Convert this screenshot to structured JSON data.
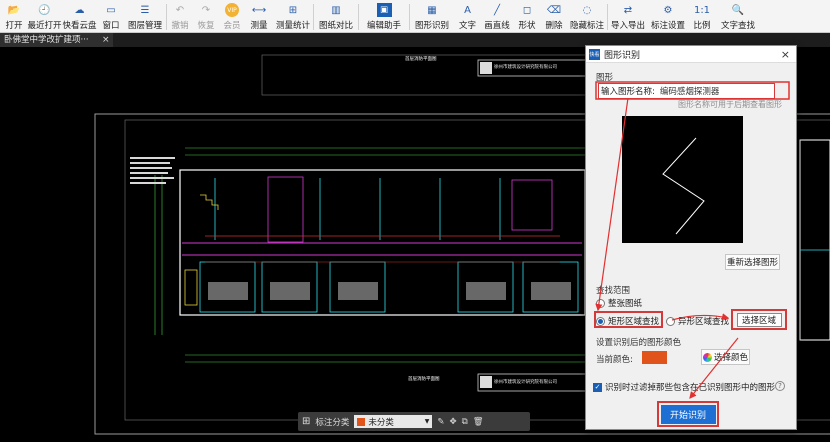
{
  "toolbar": {
    "buttons": [
      {
        "label": "打开",
        "icon": "folder-open-icon",
        "disabled": false
      },
      {
        "label": "最近打开",
        "icon": "recent-clock-icon",
        "disabled": false
      },
      {
        "label": "快看云盘",
        "icon": "cloud-icon",
        "disabled": false
      },
      {
        "label": "窗口",
        "icon": "window-icon",
        "disabled": false
      },
      {
        "label": "图层管理",
        "icon": "layers-icon",
        "disabled": false
      },
      {
        "label": "撤销",
        "icon": "undo-icon",
        "disabled": true
      },
      {
        "label": "恢复",
        "icon": "redo-icon",
        "disabled": true
      },
      {
        "label": "会员",
        "icon": "vip-badge-icon",
        "disabled": true
      },
      {
        "label": "测量",
        "icon": "measure-icon",
        "disabled": false
      },
      {
        "label": "测量统计",
        "icon": "measure-stats-icon",
        "disabled": false
      },
      {
        "label": "图纸对比",
        "icon": "compare-icon",
        "disabled": false
      },
      {
        "label": "编辑助手",
        "icon": "edit-assistant-icon",
        "disabled": false
      },
      {
        "label": "图形识别",
        "icon": "shape-recognition-icon",
        "disabled": false
      },
      {
        "label": "文字",
        "icon": "text-icon",
        "disabled": false
      },
      {
        "label": "画直线",
        "icon": "line-icon",
        "disabled": false
      },
      {
        "label": "形状",
        "icon": "shape-icon",
        "disabled": false
      },
      {
        "label": "删除",
        "icon": "eraser-icon",
        "disabled": false
      },
      {
        "label": "隐藏标注",
        "icon": "hide-annotation-icon",
        "disabled": false
      },
      {
        "label": "导入导出",
        "icon": "import-export-icon",
        "disabled": false
      },
      {
        "label": "标注设置",
        "icon": "annotation-settings-icon",
        "disabled": false
      },
      {
        "label": "比例",
        "icon": "scale-icon",
        "disabled": false
      },
      {
        "label": "文字查找",
        "icon": "text-search-icon",
        "disabled": false
      }
    ],
    "vip_text": "VIP"
  },
  "document_tab": {
    "title": "卧佛堂中学改扩建项···",
    "close": "×"
  },
  "floatbar": {
    "label": "标注分类",
    "selected": "未分类"
  },
  "dialog": {
    "title": "图形识别",
    "logo_text": "快看",
    "close": "×",
    "shape_section": "图形",
    "name_label": "输入图形名称:",
    "name_value": "编码感烟探测器",
    "name_hint": "图形名称可用于后期查看图形",
    "reselect_button": "重新选择图形",
    "scope_section": "查找范围",
    "option_whole": "整张图纸",
    "option_rect": "矩形区域查找",
    "option_polygon": "异形区域查找",
    "select_region_button": "选择区域",
    "color_section": "设置识别后的图形颜色",
    "current_color_label": "当前颜色:",
    "current_color": "#e0531a",
    "choose_color_button": "选择颜色",
    "filter_label": "识别时过滤掉那些包含在已识别图形中的图形",
    "help": "?",
    "start_button": "开始识别"
  },
  "drawing": {
    "title_block_company": "徐州市建筑设计研究院有限公司",
    "title_block_company_en": "XUZHOU INSTITUTE OF ARCHITECTURAL DESIGN",
    "bottom_plan_label": "首层消防平面图",
    "top_plan_label": "首层消防平面图"
  }
}
